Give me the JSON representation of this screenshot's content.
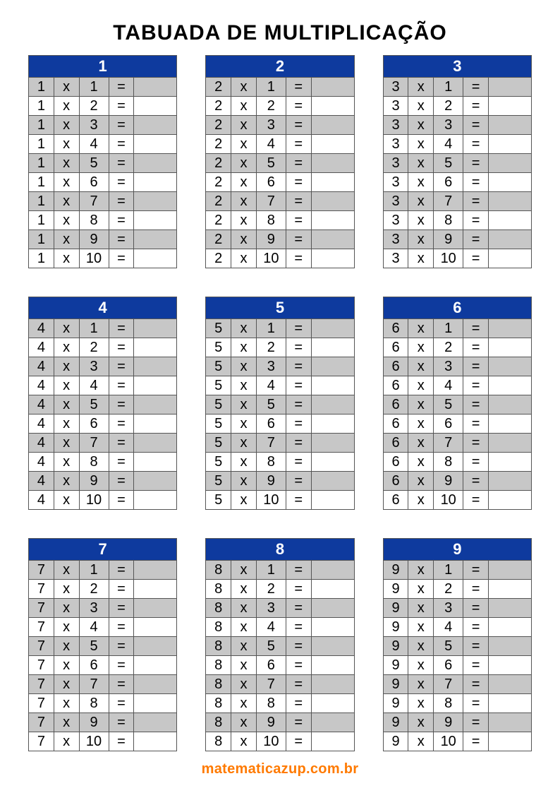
{
  "title": "TABUADA DE MULTIPLICAÇÃO",
  "symbols": {
    "times": "x",
    "equals": "="
  },
  "footer": "matematicazup.com.br",
  "colors": {
    "header_bg": "#0e3a9e",
    "row_shade": "#c7c7c7",
    "footer": "#ff7a00"
  },
  "chart_data": {
    "type": "table",
    "title": "Multiplication tables 1–9 (blank answers)",
    "tables": [
      {
        "n": 1,
        "rows": [
          [
            1,
            1
          ],
          [
            1,
            2
          ],
          [
            1,
            3
          ],
          [
            1,
            4
          ],
          [
            1,
            5
          ],
          [
            1,
            6
          ],
          [
            1,
            7
          ],
          [
            1,
            8
          ],
          [
            1,
            9
          ],
          [
            1,
            10
          ]
        ]
      },
      {
        "n": 2,
        "rows": [
          [
            2,
            1
          ],
          [
            2,
            2
          ],
          [
            2,
            3
          ],
          [
            2,
            4
          ],
          [
            2,
            5
          ],
          [
            2,
            6
          ],
          [
            2,
            7
          ],
          [
            2,
            8
          ],
          [
            2,
            9
          ],
          [
            2,
            10
          ]
        ]
      },
      {
        "n": 3,
        "rows": [
          [
            3,
            1
          ],
          [
            3,
            2
          ],
          [
            3,
            3
          ],
          [
            3,
            4
          ],
          [
            3,
            5
          ],
          [
            3,
            6
          ],
          [
            3,
            7
          ],
          [
            3,
            8
          ],
          [
            3,
            9
          ],
          [
            3,
            10
          ]
        ]
      },
      {
        "n": 4,
        "rows": [
          [
            4,
            1
          ],
          [
            4,
            2
          ],
          [
            4,
            3
          ],
          [
            4,
            4
          ],
          [
            4,
            5
          ],
          [
            4,
            6
          ],
          [
            4,
            7
          ],
          [
            4,
            8
          ],
          [
            4,
            9
          ],
          [
            4,
            10
          ]
        ]
      },
      {
        "n": 5,
        "rows": [
          [
            5,
            1
          ],
          [
            5,
            2
          ],
          [
            5,
            3
          ],
          [
            5,
            4
          ],
          [
            5,
            5
          ],
          [
            5,
            6
          ],
          [
            5,
            7
          ],
          [
            5,
            8
          ],
          [
            5,
            9
          ],
          [
            5,
            10
          ]
        ]
      },
      {
        "n": 6,
        "rows": [
          [
            6,
            1
          ],
          [
            6,
            2
          ],
          [
            6,
            3
          ],
          [
            6,
            4
          ],
          [
            6,
            5
          ],
          [
            6,
            6
          ],
          [
            6,
            7
          ],
          [
            6,
            8
          ],
          [
            6,
            9
          ],
          [
            6,
            10
          ]
        ]
      },
      {
        "n": 7,
        "rows": [
          [
            7,
            1
          ],
          [
            7,
            2
          ],
          [
            7,
            3
          ],
          [
            7,
            4
          ],
          [
            7,
            5
          ],
          [
            7,
            6
          ],
          [
            7,
            7
          ],
          [
            7,
            8
          ],
          [
            7,
            9
          ],
          [
            7,
            10
          ]
        ]
      },
      {
        "n": 8,
        "rows": [
          [
            8,
            1
          ],
          [
            8,
            2
          ],
          [
            8,
            3
          ],
          [
            8,
            4
          ],
          [
            8,
            5
          ],
          [
            8,
            6
          ],
          [
            8,
            7
          ],
          [
            8,
            8
          ],
          [
            8,
            9
          ],
          [
            8,
            10
          ]
        ]
      },
      {
        "n": 9,
        "rows": [
          [
            9,
            1
          ],
          [
            9,
            2
          ],
          [
            9,
            3
          ],
          [
            9,
            4
          ],
          [
            9,
            5
          ],
          [
            9,
            6
          ],
          [
            9,
            7
          ],
          [
            9,
            8
          ],
          [
            9,
            9
          ],
          [
            9,
            10
          ]
        ]
      }
    ]
  }
}
